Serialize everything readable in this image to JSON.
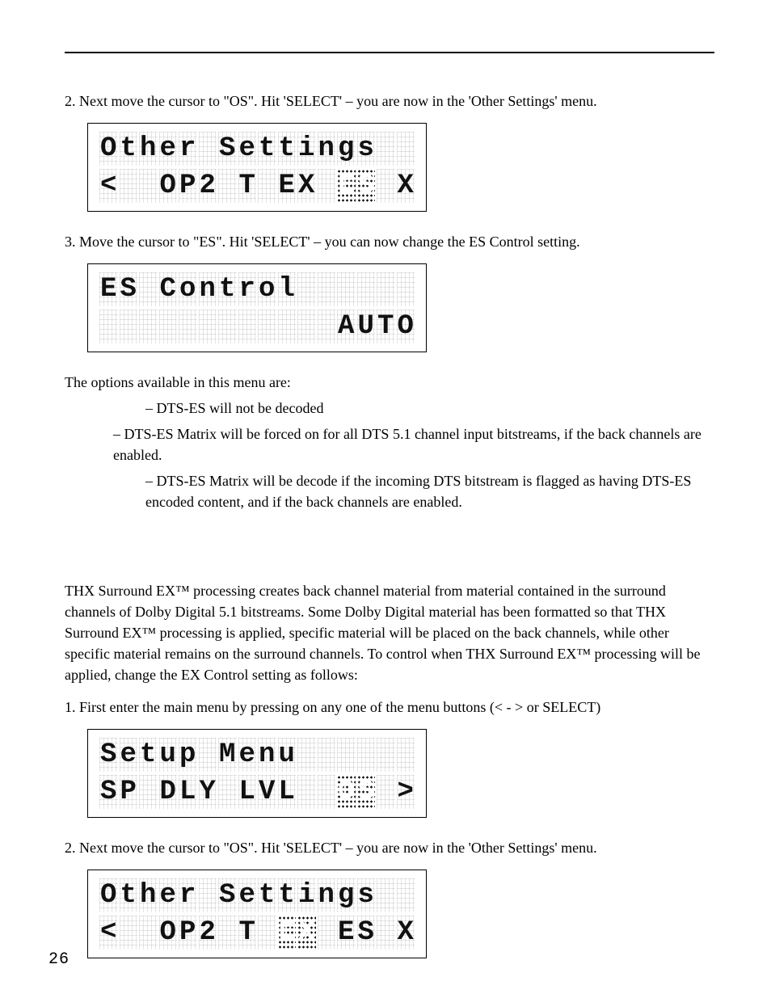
{
  "steps": {
    "s2a": "2.  Next move the cursor to \"OS\".  Hit 'SELECT' – you are now in the 'Other Settings' menu.",
    "s3": "3.  Move the cursor to \"ES\". Hit 'SELECT' – you can now change the ES Control setting.",
    "options_intro": "The options available in this menu are:",
    "opt_off": "– DTS-ES will not be decoded",
    "opt_on": "– DTS-ES Matrix will be forced on for all DTS 5.1 channel input bitstreams, if the back channels are enabled.",
    "opt_auto": "– DTS-ES Matrix will be decode if the incoming DTS bitstream is flagged as having DTS-ES encoded content, and if the back channels are enabled.",
    "thx_para": "THX Surround EX™ processing creates back channel material from material contained in the surround channels of Dolby Digital 5.1 bitstreams. Some Dolby Digital material has been formatted so that THX Surround EX™ processing is applied, specific material will be placed on the back channels, while other specific material remains on the surround channels. To control when THX Surround EX™ processing will be applied, change the EX Control setting as follows:",
    "s1": "1.  First enter the main menu by pressing on any one of the menu buttons (< - > or SELECT)",
    "s2b": "2.  Next move the cursor to \"OS\".  Hit 'SELECT' – you are now in the 'Other Settings' menu."
  },
  "lcd": {
    "other_es": {
      "row1": [
        "O",
        "t",
        "h",
        "e",
        "r",
        " ",
        "S",
        "e",
        "t",
        "t",
        "i",
        "n",
        "g",
        "s",
        " ",
        " "
      ],
      "row2": [
        "<",
        " ",
        " ",
        "O",
        "P",
        "2",
        " ",
        "T",
        " ",
        "E",
        "X",
        " ",
        "E",
        "S",
        " ",
        "X"
      ],
      "dense2": [
        12,
        13
      ]
    },
    "es_control": {
      "row1": [
        "E",
        "S",
        " ",
        "C",
        "o",
        "n",
        "t",
        "r",
        "o",
        "l",
        " ",
        " ",
        " ",
        " ",
        " ",
        " "
      ],
      "row2": [
        " ",
        " ",
        " ",
        " ",
        " ",
        " ",
        " ",
        " ",
        " ",
        " ",
        " ",
        " ",
        "A",
        "U",
        "T",
        "O"
      ],
      "dense2": []
    },
    "setup_menu": {
      "row1": [
        "S",
        "e",
        "t",
        "u",
        "p",
        " ",
        "M",
        "e",
        "n",
        "u",
        " ",
        " ",
        " ",
        " ",
        " ",
        " "
      ],
      "row2": [
        "S",
        "P",
        " ",
        "D",
        "L",
        "Y",
        " ",
        "L",
        "V",
        "L",
        " ",
        " ",
        "O",
        "S",
        " ",
        ">"
      ],
      "dense2": [
        12,
        13
      ]
    },
    "other_ex": {
      "row1": [
        "O",
        "t",
        "h",
        "e",
        "r",
        " ",
        "S",
        "e",
        "t",
        "t",
        "i",
        "n",
        "g",
        "s",
        " ",
        " "
      ],
      "row2": [
        "<",
        " ",
        " ",
        "O",
        "P",
        "2",
        " ",
        "T",
        " ",
        "E",
        "X",
        " ",
        "E",
        "S",
        " ",
        "X"
      ],
      "dense2": [
        9,
        10
      ]
    }
  },
  "page_number": "26"
}
